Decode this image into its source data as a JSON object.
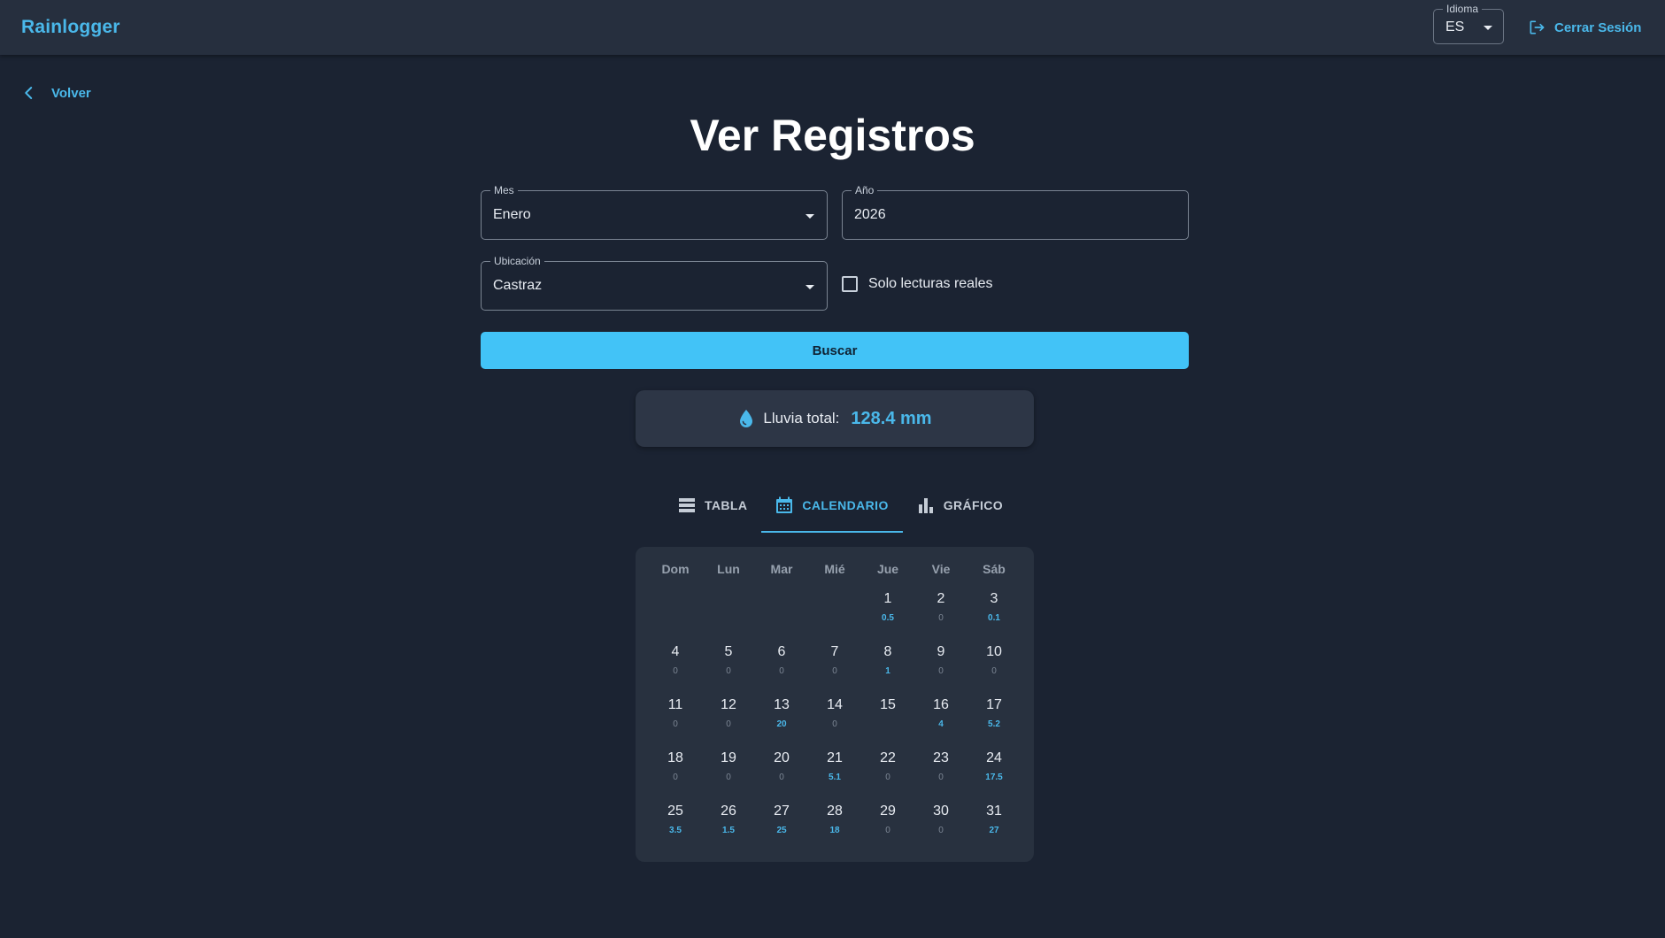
{
  "header": {
    "brand": "Rainlogger",
    "language_label": "Idioma",
    "language_value": "ES",
    "logout_label": "Cerrar Sesión"
  },
  "nav": {
    "back_label": "Volver"
  },
  "page_title": "Ver Registros",
  "filters": {
    "month": {
      "label": "Mes",
      "value": "Enero"
    },
    "year": {
      "label": "Año",
      "value": "2026"
    },
    "location": {
      "label": "Ubicación",
      "value": "Castraz"
    },
    "real_only_label": "Solo lecturas reales",
    "search_label": "Buscar"
  },
  "summary": {
    "label": "Lluvia total:",
    "value": "128.4 mm"
  },
  "tabs": [
    {
      "label": "TABLA",
      "icon": "table-icon",
      "active": false
    },
    {
      "label": "CALENDARIO",
      "icon": "calendar-icon",
      "active": true
    },
    {
      "label": "GRÁFICO",
      "icon": "bar-chart-icon",
      "active": false
    }
  ],
  "calendar": {
    "weekdays": [
      "Dom",
      "Lun",
      "Mar",
      "Mié",
      "Jue",
      "Vie",
      "Sáb"
    ],
    "leading_blanks": 4,
    "days": [
      {
        "day": "1",
        "rain": "0.5"
      },
      {
        "day": "2",
        "rain": "0"
      },
      {
        "day": "3",
        "rain": "0.1"
      },
      {
        "day": "4",
        "rain": "0"
      },
      {
        "day": "5",
        "rain": "0"
      },
      {
        "day": "6",
        "rain": "0"
      },
      {
        "day": "7",
        "rain": "0"
      },
      {
        "day": "8",
        "rain": "1"
      },
      {
        "day": "9",
        "rain": "0"
      },
      {
        "day": "10",
        "rain": "0"
      },
      {
        "day": "11",
        "rain": "0"
      },
      {
        "day": "12",
        "rain": "0"
      },
      {
        "day": "13",
        "rain": "20"
      },
      {
        "day": "14",
        "rain": "0"
      },
      {
        "day": "15",
        "rain": ""
      },
      {
        "day": "16",
        "rain": "4"
      },
      {
        "day": "17",
        "rain": "5.2"
      },
      {
        "day": "18",
        "rain": "0"
      },
      {
        "day": "19",
        "rain": "0"
      },
      {
        "day": "20",
        "rain": "0"
      },
      {
        "day": "21",
        "rain": "5.1"
      },
      {
        "day": "22",
        "rain": "0"
      },
      {
        "day": "23",
        "rain": "0"
      },
      {
        "day": "24",
        "rain": "17.5"
      },
      {
        "day": "25",
        "rain": "3.5"
      },
      {
        "day": "26",
        "rain": "1.5"
      },
      {
        "day": "27",
        "rain": "25"
      },
      {
        "day": "28",
        "rain": "18"
      },
      {
        "day": "29",
        "rain": "0"
      },
      {
        "day": "30",
        "rain": "0"
      },
      {
        "day": "31",
        "rain": "27"
      }
    ]
  },
  "colors": {
    "accent": "#4ab8ea",
    "button": "#42c3f7",
    "background": "#1b2332",
    "topbar": "#262f3e"
  }
}
